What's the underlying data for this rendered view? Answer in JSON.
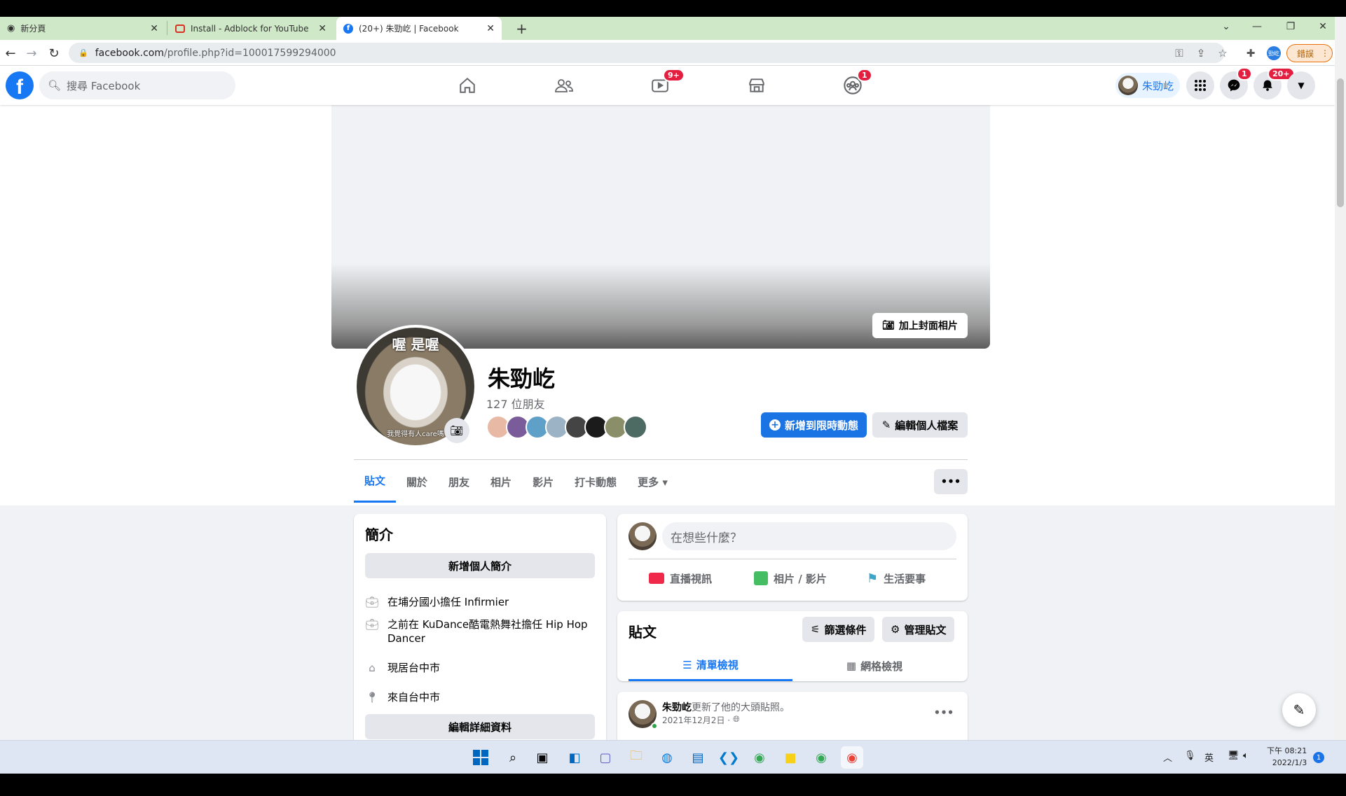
{
  "browser": {
    "tabs": [
      {
        "title": "新分頁",
        "close": "✕"
      },
      {
        "title": "Install - Adblock for YouTube",
        "close": "✕"
      },
      {
        "title": "(20+) 朱勁屹 | Facebook",
        "close": "✕"
      }
    ],
    "new_tab": "+",
    "url_host": "facebook.com",
    "url_path": "/profile.php?id=100017599294000",
    "profile_label": "勁屹",
    "error_button": "錯誤"
  },
  "fb": {
    "search_placeholder": "搜尋 Facebook",
    "video_badge": "9+",
    "groups_badge": "1",
    "profile_pill_name": "朱勁屹",
    "messenger_badge": "1",
    "notif_badge": "20+"
  },
  "profile": {
    "cover_button": "加上封面相片",
    "avatar_caption_top": "喔 是喔",
    "avatar_caption_bottom": "我覺得有人care嗎",
    "name": "朱勁屹",
    "friends": "127 位朋友",
    "add_story": "新增到限時動態",
    "edit_profile": "編輯個人檔案",
    "tabs": [
      "貼文",
      "關於",
      "朋友",
      "相片",
      "影片",
      "打卡動態",
      "更多 ▾"
    ],
    "more_dots": "•••"
  },
  "intro": {
    "title": "簡介",
    "add_bio": "新增個人簡介",
    "rows": [
      "在埔分國小擔任 Infirmier",
      "之前在 KuDance酷電熱舞社擔任 Hip Hop Dancer",
      "現居台中市",
      "來自台中市"
    ],
    "edit_details": "編輯詳細資料"
  },
  "composer": {
    "placeholder": "在想些什麼？",
    "actions": [
      "直播視訊",
      "相片 / 影片",
      "生活要事"
    ]
  },
  "posts": {
    "title": "貼文",
    "filter": "篩選條件",
    "manage": "管理貼文",
    "list_view": "清單檢視",
    "grid_view": "網格檢視"
  },
  "post": {
    "author": "朱勁屹",
    "action": "更新了他的大頭貼照。",
    "date": "2021年12月2日 ·",
    "dots": "•••"
  },
  "taskbar": {
    "lang": "英",
    "time": "下午 08:21",
    "date": "2022/1/3",
    "notif_count": "1"
  },
  "colors": {
    "fb_blue": "#1877f2",
    "badge_red": "#e41e3f",
    "tabbar_green": "#cfe8c7"
  }
}
